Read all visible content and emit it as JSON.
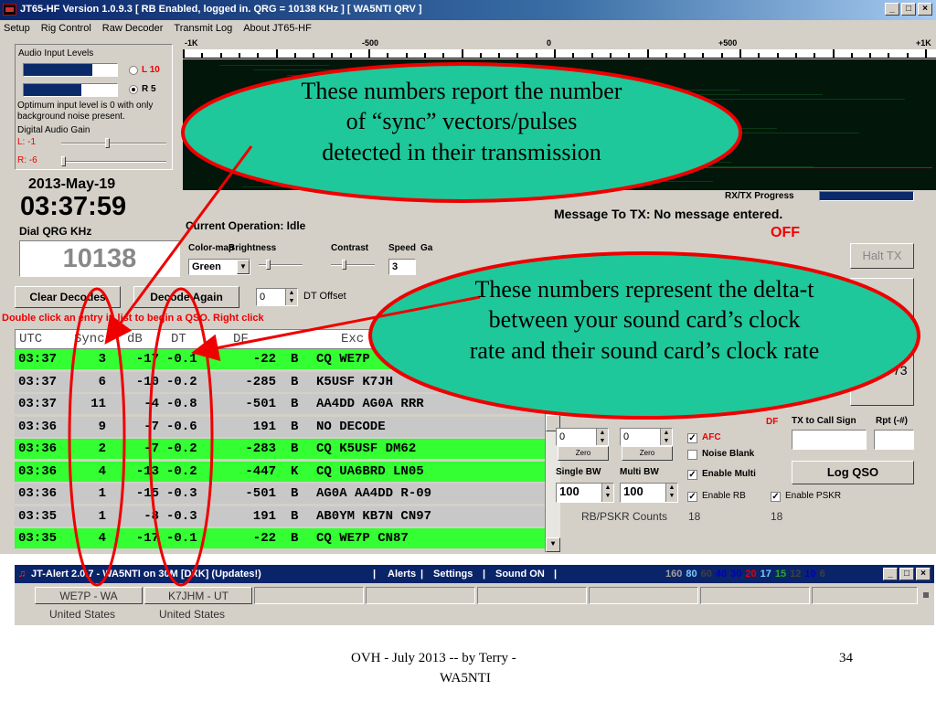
{
  "window": {
    "title": "JT65-HF Version 1.0.9.3  [ RB Enabled, logged in.  QRG = 10138 KHz ] [ WA5NTI QRV ]",
    "buttons": [
      "_",
      "□",
      "×"
    ]
  },
  "menu": [
    "Setup",
    "Rig Control",
    "Raw Decoder",
    "Transmit Log",
    "About JT65-HF"
  ],
  "audio": {
    "heading": "Audio Input Levels",
    "left_label": "L 10",
    "right_label": "R 5",
    "left_level": 0.74,
    "right_level": 0.62,
    "selected_channel": "R",
    "note": "Optimum input level is 0 with only background noise present.",
    "digital_gain_label": "Digital Audio Gain",
    "gain_left": "L: -1",
    "gain_right": "R: -6"
  },
  "clock": {
    "date": "2013-May-19",
    "time": "03:37:59",
    "dial_label": "Dial QRG KHz",
    "dial_value": "10138"
  },
  "waterfall": {
    "scale_labels": [
      "-1K",
      "-500",
      "0",
      "+500",
      "+1K"
    ],
    "rxtx_label": "RX/TX Progress",
    "colors": {
      "background": "#02160a",
      "marker": "#cc0000"
    }
  },
  "status": {
    "message_to_tx": "Message To TX:  No message entered.",
    "tx_status": "OFF",
    "current_operation": "Current Operation:  Idle",
    "halt_tx": "Halt TX"
  },
  "controls": {
    "colormap_label": "Color-map",
    "colormap_value": "Green",
    "brightness_label": "Brightness",
    "contrast_label": "Contrast",
    "speed_label": "Speed",
    "speed_value": "3",
    "gain_label": "Ga",
    "clear_decodes": "Clear Decodes",
    "decode_again": "Decode Again",
    "dt_offset_value": "0",
    "dt_offset_label": "DT Offset"
  },
  "decode_hint": "Double click an entry in list to begin a QSO.  Right click",
  "decodes": {
    "headers": [
      "UTC",
      "Sync",
      "dB",
      "DT",
      "DF",
      "Exc"
    ],
    "rows": [
      {
        "utc": "03:37",
        "sync": "3",
        "db": "-17",
        "dt": "-0.1",
        "df": "-22",
        "mode": "B",
        "exchange": "CQ WE7P",
        "highlight": true
      },
      {
        "utc": "03:37",
        "sync": "6",
        "db": "-10",
        "dt": "-0.2",
        "df": "-285",
        "mode": "B",
        "exchange": "K5USF K7JH",
        "highlight": false
      },
      {
        "utc": "03:37",
        "sync": "11",
        "db": "-4",
        "dt": "-0.8",
        "df": "-501",
        "mode": "B",
        "exchange": "AA4DD AG0A RRR",
        "highlight": false
      },
      {
        "utc": "03:36",
        "sync": "9",
        "db": "-7",
        "dt": "-0.6",
        "df": "191",
        "mode": "B",
        "exchange": "NO DECODE",
        "highlight": false
      },
      {
        "utc": "03:36",
        "sync": "2",
        "db": "-7",
        "dt": "-0.2",
        "df": "-283",
        "mode": "B",
        "exchange": "CQ K5USF DM62",
        "highlight": true
      },
      {
        "utc": "03:36",
        "sync": "4",
        "db": "-13",
        "dt": "-0.2",
        "df": "-447",
        "mode": "K",
        "exchange": "CQ UA6BRD LN05",
        "highlight": true
      },
      {
        "utc": "03:36",
        "sync": "1",
        "db": "-15",
        "dt": "-0.3",
        "df": "-501",
        "mode": "B",
        "exchange": "AG0A AA4DD R-09",
        "highlight": false
      },
      {
        "utc": "03:35",
        "sync": "1",
        "db": "-8",
        "dt": "-0.3",
        "df": "191",
        "mode": "B",
        "exchange": "AB0YM KB7N CN97",
        "highlight": false
      },
      {
        "utc": "03:35",
        "sync": "4",
        "db": "-17",
        "dt": "-0.1",
        "df": "-22",
        "mode": "B",
        "exchange": "CQ WE7P CN87",
        "highlight": true
      }
    ],
    "colors": {
      "highlight": "#33ff33",
      "normal": "#c8c8c8"
    }
  },
  "right_panel": {
    "partial_number": "73",
    "partial_df": "DF",
    "spin_a": "0",
    "spin_b": "0",
    "zero_a": "Zero",
    "zero_b": "Zero",
    "afc": "AFC",
    "noise_blank": "Noise Blank",
    "single_bw_label": "Single BW",
    "multi_bw_label": "Multi BW",
    "single_bw": "100",
    "multi_bw": "100",
    "enable_multi": "Enable Multi",
    "enable_rb": "Enable RB",
    "enable_pskr": "Enable PSKR",
    "tx_call_label": "TX to Call Sign",
    "rpt_label": "Rpt (-#)",
    "log_qso": "Log QSO",
    "counts_label": "RB/PSKR Counts",
    "count_rb": "18",
    "count_pskr": "18"
  },
  "jtalert": {
    "title": "JT-Alert 2.0.7 - WA5NTI on 30M [DXK] (Updates!)",
    "menu": [
      "Alerts",
      "Settings",
      "Sound ON"
    ],
    "bands": [
      {
        "label": "160",
        "color": "#a0a0a0"
      },
      {
        "label": "80",
        "color": "#7ec8ff"
      },
      {
        "label": "60",
        "color": "#404040"
      },
      {
        "label": "40",
        "color": "#0000c0"
      },
      {
        "label": "30",
        "color": "#0000c0"
      },
      {
        "label": "20",
        "color": "#e00000"
      },
      {
        "label": "17",
        "color": "#7ec8ff"
      },
      {
        "label": "15",
        "color": "#2aa82a"
      },
      {
        "label": "12",
        "color": "#404040"
      },
      {
        "label": "10",
        "color": "#0000c0"
      },
      {
        "label": "6",
        "color": "#404040"
      }
    ],
    "calls": [
      "WE7P - WA",
      "K7JHM - UT"
    ],
    "countries": [
      "United States",
      "United States"
    ]
  },
  "annotations": {
    "sync_bubble": [
      "These numbers report the number",
      "of “sync” vectors/pulses",
      "detected in their transmission"
    ],
    "dt_bubble": [
      "These numbers represent the delta-t",
      "between your sound card’s clock",
      "rate and their sound card’s clock rate"
    ],
    "bubble_color": "#1ec89a"
  },
  "footer": {
    "credit_line1": "OVH -  July  2013  -- by  Terry -",
    "credit_line2": "WA5NTI",
    "page_number": "34"
  }
}
